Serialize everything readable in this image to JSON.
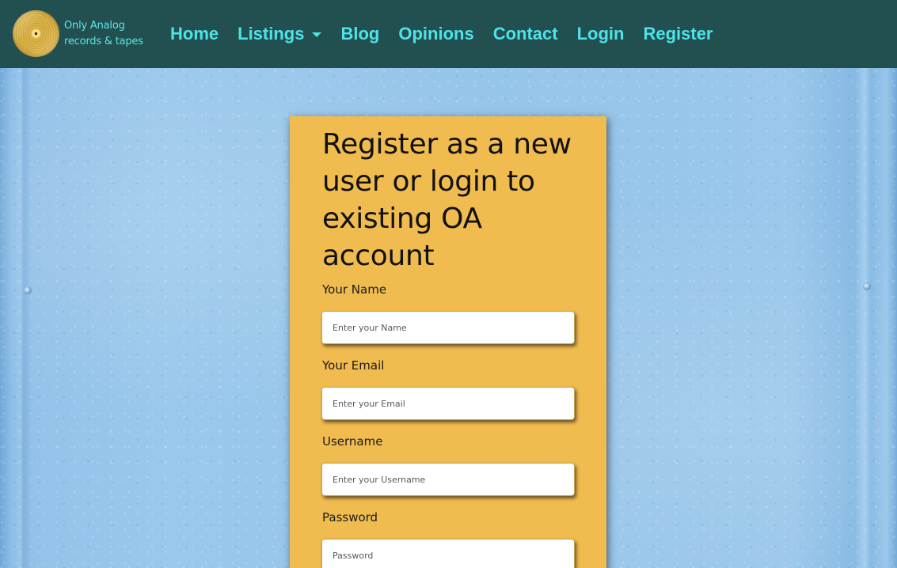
{
  "brand": {
    "line1": "Only Analog",
    "line2": "records & tapes",
    "logo_icon": "gold-vinyl-record-icon"
  },
  "nav": {
    "items": [
      {
        "label": "Home"
      },
      {
        "label": "Listings",
        "dropdown": true
      },
      {
        "label": "Blog"
      },
      {
        "label": "Opinions"
      },
      {
        "label": "Contact"
      },
      {
        "label": "Login"
      },
      {
        "label": "Register"
      }
    ]
  },
  "form": {
    "title": "Register as a new user or login to existing OA account",
    "fields": [
      {
        "label": "Your Name",
        "placeholder": "Enter your Name"
      },
      {
        "label": "Your Email",
        "placeholder": "Enter your Email"
      },
      {
        "label": "Username",
        "placeholder": "Enter your Username"
      },
      {
        "label": "Password",
        "placeholder": "Password"
      }
    ]
  },
  "colors": {
    "navbar_bg": "#224f4f",
    "nav_link": "#4de3e8",
    "card_bg": "#f0bb4f",
    "page_bg": "#8fbde4"
  }
}
